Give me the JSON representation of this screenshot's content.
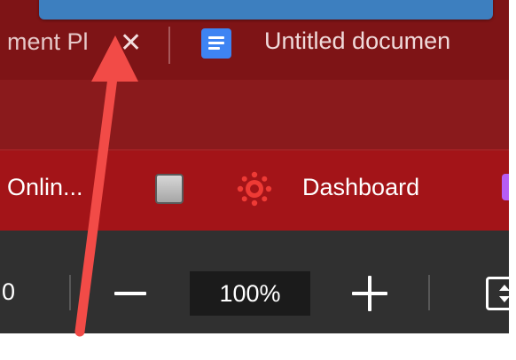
{
  "browser": {
    "tabs": [
      {
        "title": "ment Pl",
        "close_glyph": "✕"
      },
      {
        "title": "Untitled documen",
        "icon": "google-docs-icon"
      }
    ]
  },
  "bookmarks": {
    "items": [
      {
        "label": "Onlin..."
      },
      {
        "label": "",
        "icon": "gray-square-icon"
      },
      {
        "label": "Dashboard",
        "icon": "canvas-logo-icon"
      },
      {
        "label": "",
        "icon": "purple-bookmark-icon"
      }
    ]
  },
  "zoom_bar": {
    "left_value": "0",
    "level": "100%",
    "minus_icon": "minus-icon",
    "plus_icon": "plus-icon",
    "fit_icon": "fit-to-page-icon"
  },
  "annotation": {
    "arrow_color": "#f24b47"
  },
  "colors": {
    "tab_strip": "#7e1416",
    "toolbar": "#8a1a1c",
    "bookmarks_bar": "#a31418",
    "zoom_bar": "#303030",
    "tooltip": "#3d7fbf",
    "docs_blue": "#3e84f3"
  }
}
